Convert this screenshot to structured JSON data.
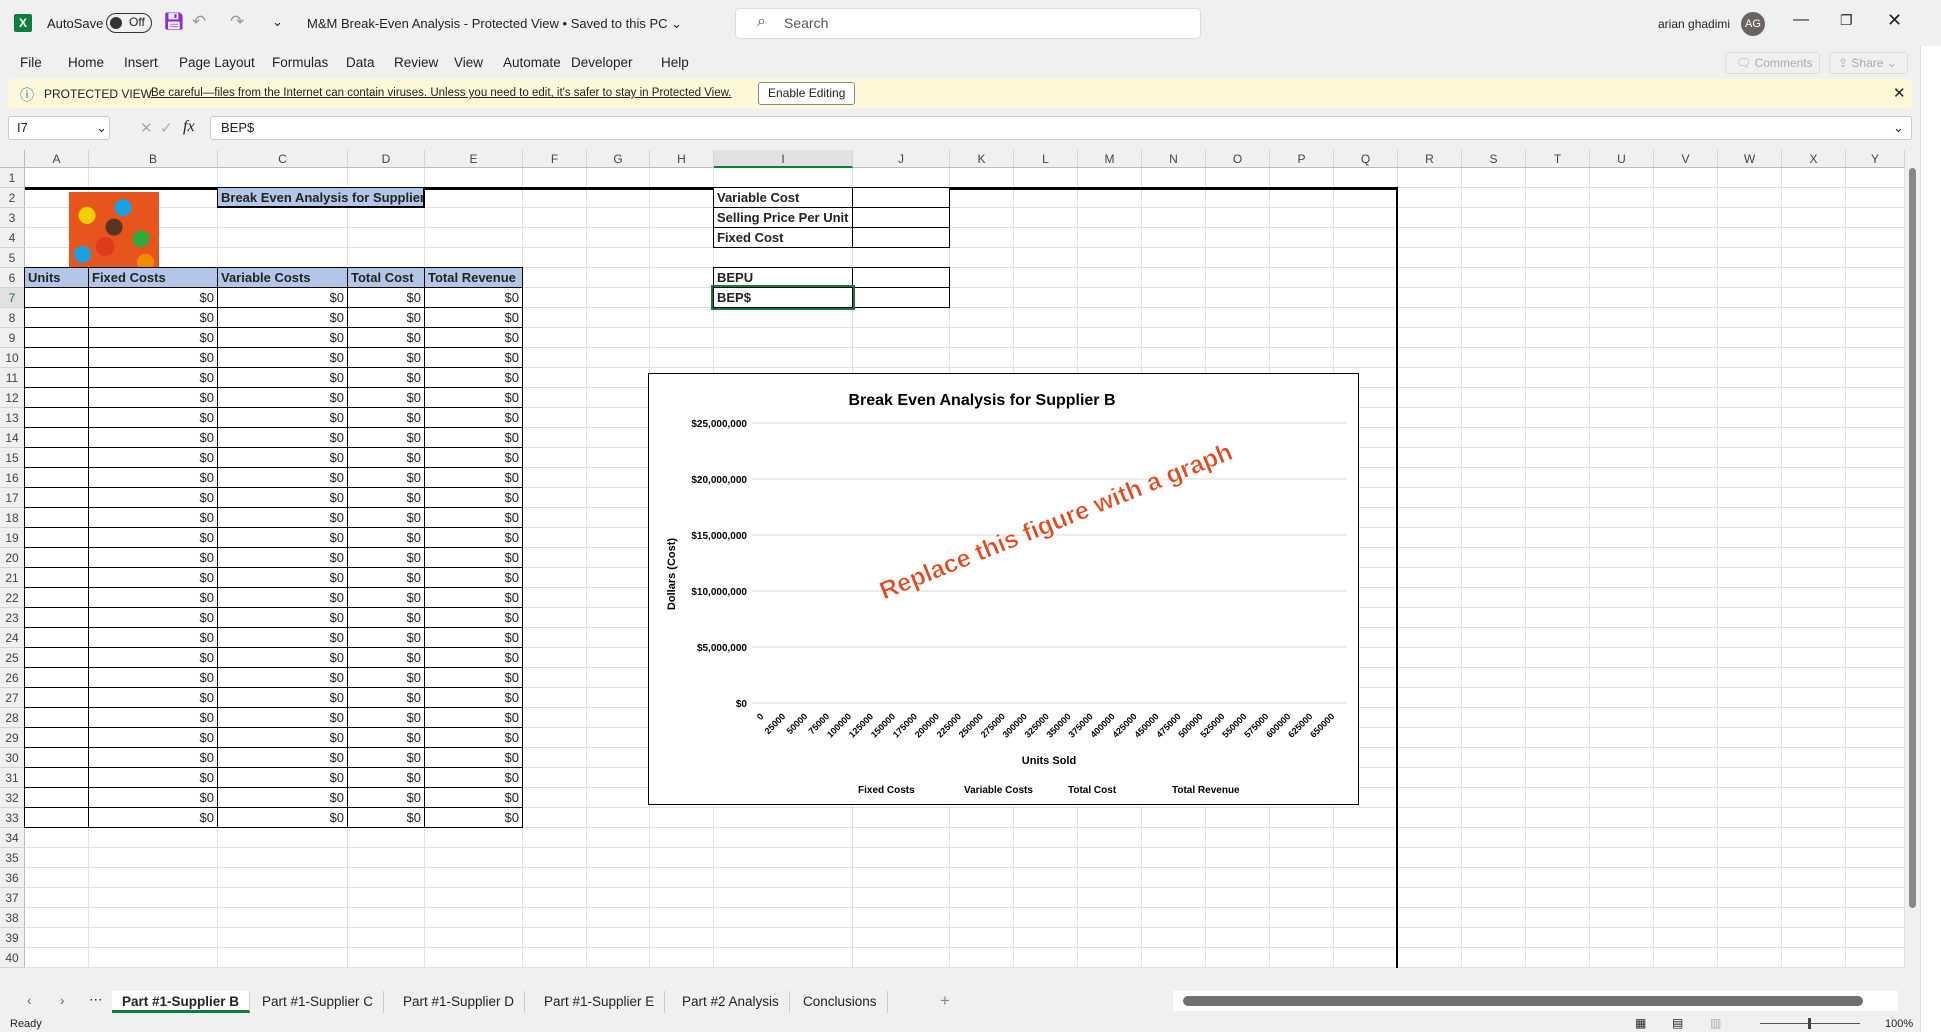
{
  "titlebar": {
    "autosave": "AutoSave",
    "toggle": "Off",
    "title": "M&M Break-Even Analysis  -  Protected View • Saved to this PC ⌄",
    "search_placeholder": "Search",
    "user": "arian ghadimi",
    "initials": "AG"
  },
  "menu": [
    "File",
    "Home",
    "Insert",
    "Page Layout",
    "Formulas",
    "Data",
    "Review",
    "View",
    "Automate",
    "Developer",
    "Help"
  ],
  "ribbon_right": {
    "comments": "Comments",
    "share": "Share"
  },
  "protected": {
    "label": "PROTECTED VIEW",
    "message": "Be careful—files from the Internet can contain viruses. Unless you need to edit, it's safer to stay in Protected View.",
    "button": "Enable Editing"
  },
  "formula_bar": {
    "cell_ref": "I7",
    "fx": "fx",
    "value": "BEP$"
  },
  "columns": [
    "A",
    "B",
    "C",
    "D",
    "E",
    "F",
    "G",
    "H",
    "I",
    "J",
    "K",
    "L",
    "M",
    "N",
    "O",
    "P",
    "Q",
    "R",
    "S",
    "T",
    "U",
    "V",
    "W",
    "X",
    "Y"
  ],
  "sheet": {
    "title": "Break Even Analysis for Supplier B",
    "table_headers": [
      "Units",
      "Fixed Costs",
      "Variable Costs",
      "Total Cost",
      "Total Revenue"
    ],
    "rows": [
      [
        "",
        "$0",
        "$0",
        "$0",
        "$0"
      ],
      [
        "",
        "$0",
        "$0",
        "$0",
        "$0"
      ],
      [
        "",
        "$0",
        "$0",
        "$0",
        "$0"
      ],
      [
        "",
        "$0",
        "$0",
        "$0",
        "$0"
      ],
      [
        "",
        "$0",
        "$0",
        "$0",
        "$0"
      ],
      [
        "",
        "$0",
        "$0",
        "$0",
        "$0"
      ],
      [
        "",
        "$0",
        "$0",
        "$0",
        "$0"
      ],
      [
        "",
        "$0",
        "$0",
        "$0",
        "$0"
      ],
      [
        "",
        "$0",
        "$0",
        "$0",
        "$0"
      ],
      [
        "",
        "$0",
        "$0",
        "$0",
        "$0"
      ],
      [
        "",
        "$0",
        "$0",
        "$0",
        "$0"
      ],
      [
        "",
        "$0",
        "$0",
        "$0",
        "$0"
      ],
      [
        "",
        "$0",
        "$0",
        "$0",
        "$0"
      ],
      [
        "",
        "$0",
        "$0",
        "$0",
        "$0"
      ],
      [
        "",
        "$0",
        "$0",
        "$0",
        "$0"
      ],
      [
        "",
        "$0",
        "$0",
        "$0",
        "$0"
      ],
      [
        "",
        "$0",
        "$0",
        "$0",
        "$0"
      ],
      [
        "",
        "$0",
        "$0",
        "$0",
        "$0"
      ],
      [
        "",
        "$0",
        "$0",
        "$0",
        "$0"
      ],
      [
        "",
        "$0",
        "$0",
        "$0",
        "$0"
      ],
      [
        "",
        "$0",
        "$0",
        "$0",
        "$0"
      ],
      [
        "",
        "$0",
        "$0",
        "$0",
        "$0"
      ],
      [
        "",
        "$0",
        "$0",
        "$0",
        "$0"
      ],
      [
        "",
        "$0",
        "$0",
        "$0",
        "$0"
      ],
      [
        "",
        "$0",
        "$0",
        "$0",
        "$0"
      ],
      [
        "",
        "$0",
        "$0",
        "$0",
        "$0"
      ],
      [
        "",
        "$0",
        "$0",
        "$0",
        "$0"
      ]
    ],
    "inputs": [
      {
        "label": "Variable Cost",
        "value": ""
      },
      {
        "label": "Selling Price Per Unit",
        "value": ""
      },
      {
        "label": "Fixed Cost",
        "value": ""
      }
    ],
    "results": [
      {
        "label": "BEPU",
        "value": ""
      },
      {
        "label": "BEP$",
        "value": ""
      }
    ]
  },
  "chart_data": {
    "type": "line",
    "title": "Break Even Analysis for Supplier B",
    "xlabel": "Units Sold",
    "ylabel": "Dollars  (Cost)",
    "categories": [
      "0",
      "25000",
      "50000",
      "75000",
      "100000",
      "125000",
      "150000",
      "175000",
      "200000",
      "225000",
      "250000",
      "275000",
      "300000",
      "325000",
      "350000",
      "375000",
      "400000",
      "425000",
      "450000",
      "475000",
      "500000",
      "525000",
      "550000",
      "575000",
      "600000",
      "625000",
      "650000"
    ],
    "y_ticks": [
      "$0",
      "$5,000,000",
      "$10,000,000",
      "$15,000,000",
      "$20,000,000",
      "$25,000,000"
    ],
    "ylim": [
      0,
      25000000
    ],
    "grid": true,
    "legend": "bottom",
    "series": [
      {
        "name": "Fixed Costs",
        "values": []
      },
      {
        "name": "Variable Costs",
        "values": []
      },
      {
        "name": "Total Cost",
        "values": []
      },
      {
        "name": "Total Revenue",
        "values": []
      }
    ],
    "annotation": "Replace this figure with a graph",
    "annotation_color": "#e8461c"
  },
  "sheet_tabs": [
    "Part #1-Supplier B",
    "Part #1-Supplier C",
    "Part #1-Supplier D",
    "Part #1-Supplier E",
    "Part #2 Analysis",
    "Conclusions"
  ],
  "status": {
    "ready": "Ready",
    "zoom": "100%"
  },
  "colors": {
    "accent": "#107c41",
    "header_fill": "#b4c6e7"
  }
}
